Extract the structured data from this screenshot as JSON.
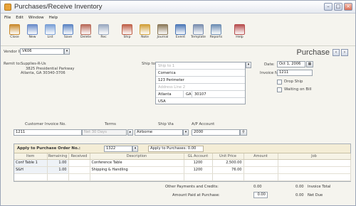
{
  "window": {
    "title": "Purchases/Receive Inventory"
  },
  "menu": [
    "File",
    "Edit",
    "Window",
    "Help"
  ],
  "toolbar": [
    {
      "label": "Close",
      "icon": "close-icon",
      "color": "#c98a2e"
    },
    {
      "label": "New",
      "icon": "new-icon",
      "color": "#6b8cc9"
    },
    {
      "label": "List",
      "icon": "list-icon",
      "color": "#7aa0d6"
    },
    {
      "label": "Save",
      "icon": "save-icon",
      "color": "#5e86c4"
    },
    {
      "label": "Delete",
      "icon": "delete-icon",
      "color": "#b96b5a"
    },
    {
      "label": "Rec",
      "icon": "recur-icon",
      "color": "#9aa9c0"
    },
    {
      "label": "Ship",
      "icon": "ship-icon",
      "color": "#c0624a"
    },
    {
      "label": "Note",
      "icon": "note-icon",
      "color": "#d2a13b"
    },
    {
      "label": "Journal",
      "icon": "journal-icon",
      "color": "#8c7a5a"
    },
    {
      "label": "Event",
      "icon": "event-icon",
      "color": "#4f7ab8"
    },
    {
      "label": "Template",
      "icon": "template-icon",
      "color": "#7b8fb0"
    },
    {
      "label": "Reports",
      "icon": "reports-icon",
      "color": "#6f8fb4"
    },
    {
      "label": "Help",
      "icon": "help-icon",
      "color": "#b84f4f"
    }
  ],
  "header": {
    "vendor_label": "Vendor ID:",
    "vendor_id": "VK06",
    "form_title": "Purchase",
    "remit_label": "Remit to:",
    "remit_lines": [
      "Supplies-R-Us",
      "3825 Presidential Parkway",
      "Atlanta, GA 30340-3706"
    ],
    "shipto_label": "Ship to:",
    "shipto": {
      "name": "Ship to 1",
      "company": "Comerica",
      "address1": "123 Perimeter",
      "address2": "Address Line 2",
      "city": "Atlanta",
      "state": "GA",
      "zip": "30107",
      "country": "USA"
    },
    "date_label": "Date:",
    "date": "Oct 1, 2006",
    "invoice_label": "Invoice No.:",
    "invoice_no": "1211",
    "drop_ship_label": "Drop Ship",
    "waiting_label": "Waiting on Bill"
  },
  "info_row": {
    "customer_invoice_label": "Customer Invoice No.",
    "terms_label": "Terms",
    "ship_via_label": "Ship Via",
    "ap_account_label": "A/P Account",
    "customer_invoice": "1211",
    "terms": "Net 30 Days",
    "ship_via": "Airborne",
    "ap_account": "2000"
  },
  "apply": {
    "label": "Apply to Purchase Order No.:",
    "po_no": "1322",
    "tab_label": "Apply to Purchases: 0.00"
  },
  "table": {
    "headers": [
      "Item",
      "Remaining",
      "Received",
      "Description",
      "GL Account",
      "Unit Price",
      "Amount",
      "Job"
    ],
    "rows": [
      [
        "Conf Table 1",
        "1.00",
        "",
        "Conference Table",
        "1200",
        "2,500.00",
        "",
        ""
      ],
      [
        "S&H",
        "1.00",
        "",
        "Shipping & Handling",
        "1200",
        "76.00",
        "",
        ""
      ]
    ]
  },
  "totals": {
    "other_label": "Other Payments and Credits:",
    "other_value": "0.00",
    "invoice_total_value": "0.00",
    "invoice_total_label": "Invoice Total",
    "paid_label": "Amount Paid at Purchase:",
    "paid_value": "0.00",
    "net_due_value": "0.00",
    "net_due_label": "Net Due"
  }
}
